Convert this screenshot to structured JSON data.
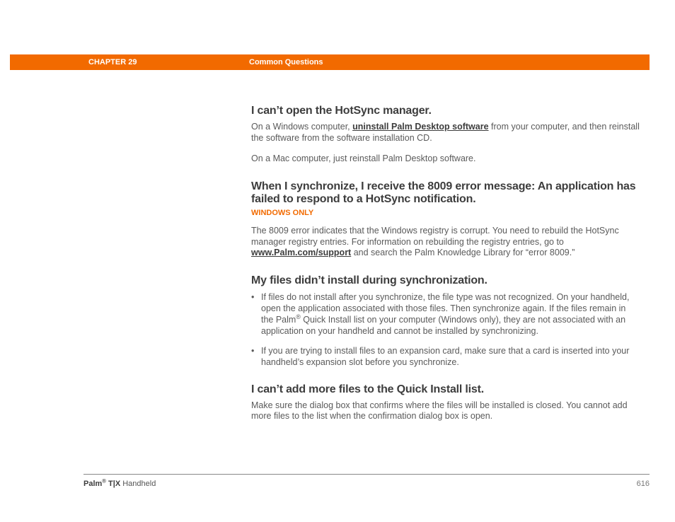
{
  "header": {
    "chapter": "CHAPTER 29",
    "section": "Common Questions"
  },
  "sections": {
    "s1": {
      "title": "I can’t open the HotSync manager.",
      "p1a": "On a Windows computer, ",
      "link1": "uninstall Palm Desktop software",
      "p1b": " from your computer, and then reinstall the software from the software installation CD.",
      "p2": "On a Mac computer, just reinstall Palm Desktop software."
    },
    "s2": {
      "title": "When I synchronize, I receive the 8009 error message: An application has failed to respond to a HotSync notification.",
      "badge": "WINDOWS ONLY",
      "p1a": "The 8009 error indicates that the Windows registry is corrupt. You need to rebuild the HotSync manager registry entries. For information on rebuilding the registry entries, go to ",
      "link": "www.Palm.com/support",
      "p1b": " and search the Palm Knowledge Library for “error 8009.”"
    },
    "s3": {
      "title": "My files didn’t install during synchronization.",
      "b1a": "If files do not install after you synchronize, the file type was not recognized. On your handheld, open the application associated with those files. Then synchronize again. If the files remain in the Palm",
      "b1sup": "®",
      "b1b": " Quick Install list on your computer (Windows only), they are not associated with an application on your handheld and cannot be installed by synchronizing.",
      "b2": "If you are trying to install files to an expansion card, make sure that a card is inserted into your handheld’s expansion slot before you synchronize."
    },
    "s4": {
      "title": "I can’t add more files to the Quick Install list.",
      "p1": "Make sure the dialog box that confirms where the files will be installed is closed. You cannot add more files to the list when the confirmation dialog box is open."
    }
  },
  "footer": {
    "brand_a": "Palm",
    "brand_sup": "®",
    "brand_b": " T|X",
    "brand_c": " Handheld",
    "page": "616"
  }
}
